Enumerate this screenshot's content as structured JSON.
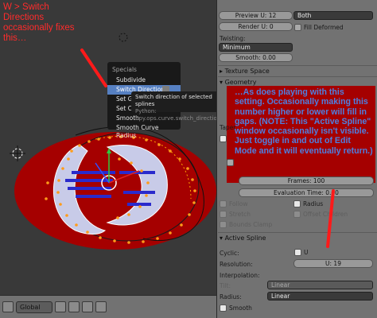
{
  "annotation_top_left": [
    "W  >  Switch",
    "Directions",
    "occasionally fixes",
    "this…"
  ],
  "specials_menu": {
    "title": "Specials",
    "items": [
      {
        "label": "Subdivide",
        "active": false
      },
      {
        "label": "Switch Direction",
        "active": true
      },
      {
        "label": "Set Goal",
        "active": false
      },
      {
        "label": "Set Curv",
        "active": false
      },
      {
        "label": "Smooth",
        "active": false
      },
      {
        "label": "Smooth Curve Radius",
        "active": false
      }
    ]
  },
  "tooltip": {
    "description": "Switch direction of selected splines",
    "python": "Python: bpy.ops.curve.switch_direction()"
  },
  "viewport_header": {
    "orientation": "Global"
  },
  "properties": {
    "preview_u": "Preview U: 12",
    "render_u": "Render U: 0",
    "fill_mode": "Both",
    "fill_deformed": "Fill Deformed",
    "twisting_label": "Twisting:",
    "twisting_value": "Minimum",
    "smooth": "Smooth: 0.00",
    "texture_space": "Texture Space",
    "geometry": "Geometry",
    "taper_label": "Taper",
    "frames": "Frames: 100",
    "evaluation_time": "Evaluation Time: 0.00",
    "follow": "Follow",
    "radius": "Radius",
    "stretch": "Stretch",
    "offset_children": "Offset Children",
    "bounds_clamp": "Bounds Clamp",
    "active_spline": "Active Spline",
    "cyclic_label": "Cyclic:",
    "cyclic_u": "U",
    "resolution_label": "Resolution:",
    "resolution_u": "U: 19",
    "interpolation_label": "Interpolation:",
    "tilt_label": "Tilt:",
    "tilt_value": "Linear",
    "radius_label": "Radius:",
    "radius_value": "Linear",
    "smooth_check": "Smooth"
  },
  "blue_annotation": "…As does playing with this setting.  Occasionally making this number higher or lower will fill in gaps.  (NOTE: This \"Active Spline\" window occasionally isn't visible.  Just toggle in and out of Edit Mode and it will eventually return.)",
  "colors": {
    "viewport_bg": "#393939",
    "panel_bg": "#727272",
    "annotation_red": "#ff2b2b",
    "annotation_blue": "#4e7fe0",
    "ellipse_red": "#a50000",
    "menu_highlight": "#5680c2"
  }
}
